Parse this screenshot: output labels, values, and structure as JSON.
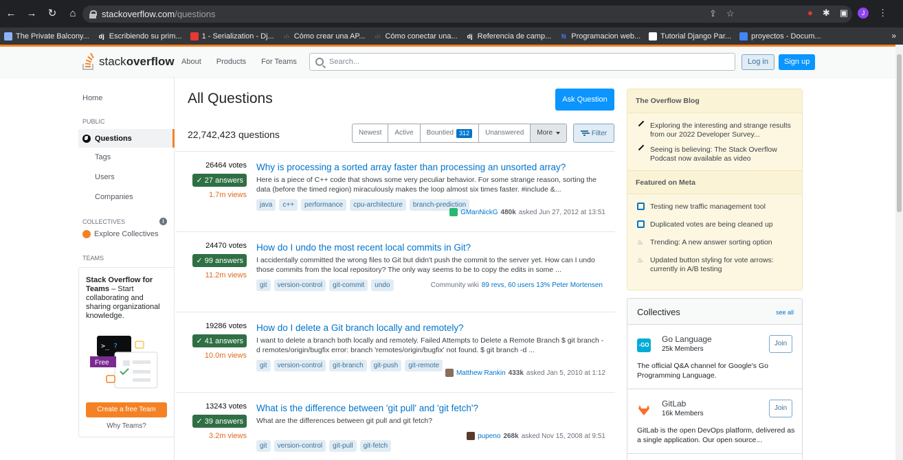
{
  "browser": {
    "url_host": "stackoverflow.com",
    "url_path": "/questions",
    "bookmarks": [
      {
        "label": "The Private Balcony...",
        "color": "#8ab4f8"
      },
      {
        "label": "Escribiendo su prim...",
        "badge": "dj",
        "color": "#0c4b33"
      },
      {
        "label": "1 - Serialization - Dj...",
        "color": "#e53935"
      },
      {
        "label": "Cómo crear una AP...",
        "badge": "‹/›",
        "color": "#5e5e5e"
      },
      {
        "label": "Cómo conectar una...",
        "badge": "‹/›",
        "color": "#5e5e5e"
      },
      {
        "label": "Referencia de camp...",
        "badge": "dj",
        "color": "#0c4b33"
      },
      {
        "label": "Programacion web...",
        "badge": "N",
        "color": "#4285f4"
      },
      {
        "label": "Tutorial Django Par...",
        "color": "#ffffff"
      },
      {
        "label": "proyectos - Docum...",
        "color": "#4285f4"
      }
    ],
    "more": "»",
    "avatar": "J"
  },
  "so": {
    "logo_light": "stack",
    "logo_bold": "overflow",
    "nav": [
      "About",
      "Products",
      "For Teams"
    ],
    "search_placeholder": "Search...",
    "login": "Log in",
    "signup": "Sign up"
  },
  "sidebar": {
    "home": "Home",
    "public": "PUBLIC",
    "questions": "Questions",
    "tags": "Tags",
    "users": "Users",
    "companies": "Companies",
    "collectives": "COLLECTIVES",
    "explore": "Explore Collectives",
    "teams": "TEAMS",
    "teams_title_bold": "Stack Overflow for Teams",
    "teams_title_rest": " – Start collaborating and sharing organizational knowledge.",
    "free": "Free",
    "create_team": "Create a free Team",
    "why_teams": "Why Teams?"
  },
  "main": {
    "title": "All Questions",
    "ask": "Ask Question",
    "count": "22,742,423 questions",
    "filters": [
      "Newest",
      "Active",
      "Bountied",
      "Unanswered"
    ],
    "bounty_count": "312",
    "more": "More",
    "filter": "Filter",
    "questions": [
      {
        "votes": "26464 votes",
        "answers": "✓ 27 answers",
        "views": "1.7m views",
        "title": "Why is processing a sorted array faster than processing an unsorted array?",
        "excerpt": "Here is a piece of C++ code that shows some very peculiar behavior. For some strange reason, sorting the data (before the timed region) miraculously makes the loop almost six times faster. #include &...",
        "tags": [
          "java",
          "c++",
          "performance",
          "cpu-architecture",
          "branch-prediction"
        ],
        "user": "GManNickG",
        "rep": "480k",
        "asked": "asked Jun 27, 2012 at 13:51",
        "avatar_color": "#2bb673"
      },
      {
        "votes": "24470 votes",
        "answers": "✓ 99 answers",
        "views": "11.2m views",
        "title": "How do I undo the most recent local commits in Git?",
        "excerpt": "I accidentally committed the wrong files to Git but didn't push the commit to the server yet. How can I undo those commits from the local repository? The only way seems to be to copy the edits in some ...",
        "tags": [
          "git",
          "version-control",
          "git-commit",
          "undo"
        ],
        "community": "Community wiki",
        "wiki_link": "89 revs, 60 users 13% Peter Mortensen"
      },
      {
        "votes": "19286 votes",
        "answers": "✓ 41 answers",
        "views": "10.0m views",
        "title": "How do I delete a Git branch locally and remotely?",
        "excerpt": "I want to delete a branch both locally and remotely. Failed Attempts to Delete a Remote Branch $ git branch -d remotes/origin/bugfix error: branch 'remotes/origin/bugfix' not found. $ git branch -d ...",
        "tags": [
          "git",
          "version-control",
          "git-branch",
          "git-push",
          "git-remote"
        ],
        "user": "Matthew Rankin",
        "rep": "433k",
        "asked": "asked Jan 5, 2010 at 1:12",
        "avatar_color": "#8a6d5a"
      },
      {
        "votes": "13243 votes",
        "answers": "✓ 39 answers",
        "views": "3.2m views",
        "title": "What is the difference between 'git pull' and 'git fetch'?",
        "excerpt": "What are the differences between git pull and git fetch?",
        "tags": [
          "git",
          "version-control",
          "git-pull",
          "git-fetch"
        ],
        "user": "pupeno",
        "rep": "268k",
        "asked": "asked Nov 15, 2008 at 9:51",
        "avatar_color": "#5a3a2a"
      }
    ]
  },
  "right": {
    "blog_title": "The Overflow Blog",
    "blog_items": [
      "Exploring the interesting and strange results from our 2022 Developer Survey...",
      "Seeing is believing: The Stack Overflow Podcast now available as video"
    ],
    "meta_title": "Featured on Meta",
    "meta_items": [
      {
        "text": "Testing new traffic management tool",
        "icon": "meta-icon"
      },
      {
        "text": "Duplicated votes are being cleaned up",
        "icon": "meta-icon"
      },
      {
        "text": "Trending: A new answer sorting option",
        "icon": "trend-icon"
      },
      {
        "text": "Updated button styling for vote arrows: currently in A/B testing",
        "icon": "trend-icon"
      }
    ],
    "collectives_title": "Collectives",
    "see_all": "see all",
    "collectives": [
      {
        "name": "Go Language",
        "members": "25k Members",
        "join": "Join",
        "desc": "The official Q&A channel for Google's Go Programming Language.",
        "logo_color": "#00acd7",
        "logo_text": "-GO"
      },
      {
        "name": "GitLab",
        "members": "16k Members",
        "join": "Join",
        "desc": "GitLab is the open DevOps platform, delivered as a single application. Our open source...",
        "logo_color": "#fc6d26",
        "logo_text": ""
      }
    ]
  },
  "colors": {
    "accent": "#f48225",
    "link": "#0074cc",
    "primary_btn": "#0a95ff",
    "answered": "#2f6f44"
  }
}
